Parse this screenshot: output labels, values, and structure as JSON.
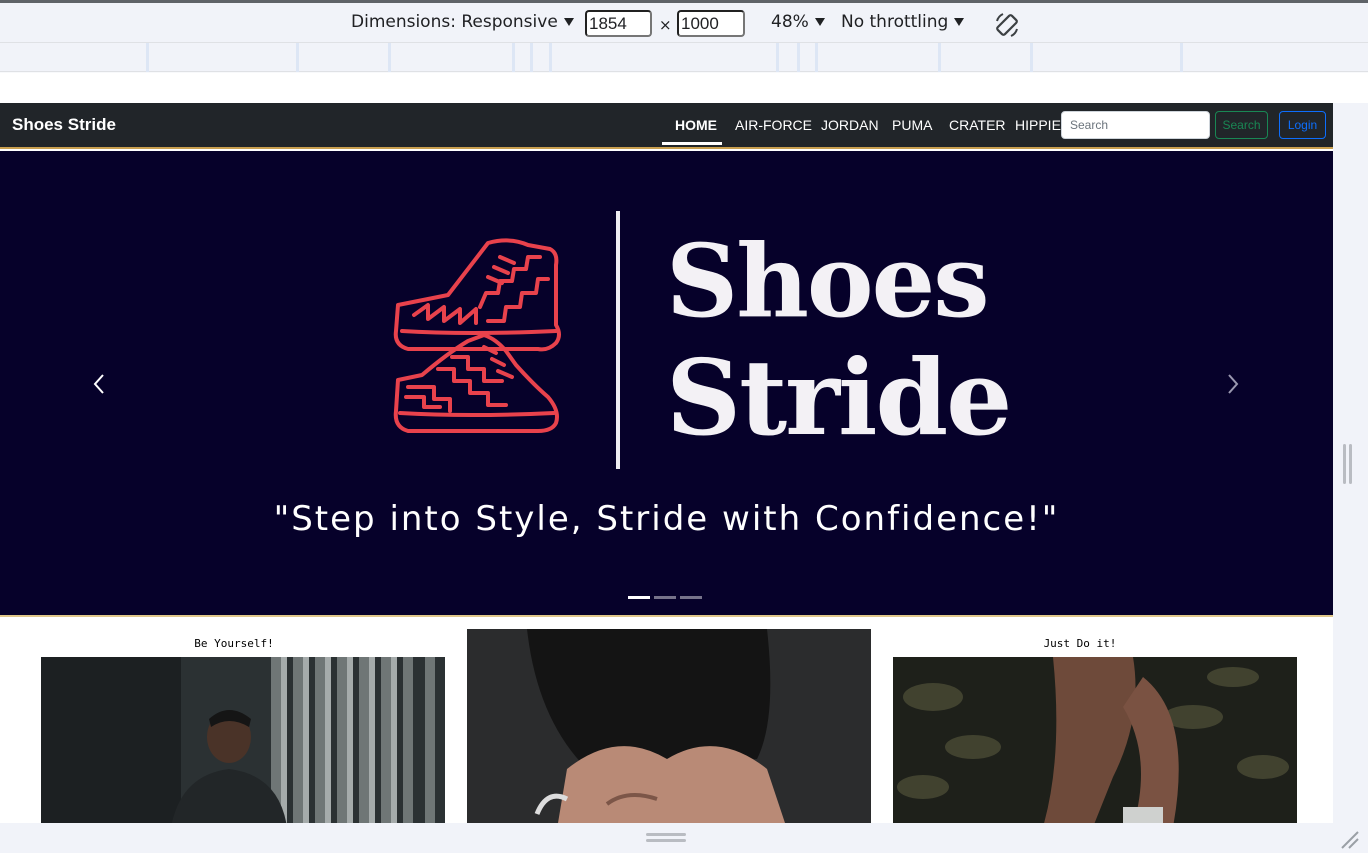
{
  "devtools": {
    "dimensions_label": "Dimensions: Responsive",
    "width_value": "1854",
    "times_sign": "×",
    "height_value": "1000",
    "zoom": "48%",
    "throttling": "No throttling",
    "icons": [
      "caret-down-icon",
      "rotate-icon",
      "resize-handle-icon"
    ]
  },
  "site": {
    "brand": "Shoes Stride",
    "nav": {
      "items": [
        {
          "label": "HOME",
          "active": true
        },
        {
          "label": "AIR-FORCE",
          "active": false
        },
        {
          "label": "JORDAN",
          "active": false
        },
        {
          "label": "PUMA",
          "active": false
        },
        {
          "label": "CRATER",
          "active": false
        },
        {
          "label": "HIPPIE",
          "active": false
        }
      ],
      "search_placeholder": "Search",
      "search_button": "Search",
      "login_button": "Login"
    },
    "hero": {
      "logo_line1": "Shoes",
      "logo_line2": "Stride",
      "tagline": "\"Step into Style, Stride with Confidence!\"",
      "active_slide": 1,
      "slide_count": 3,
      "background_color": "#06012a",
      "accent_color": "#e8424c"
    },
    "cards": [
      {
        "caption": "Be Yourself!"
      },
      {
        "caption": ""
      },
      {
        "caption": "Just Do it!"
      }
    ]
  }
}
